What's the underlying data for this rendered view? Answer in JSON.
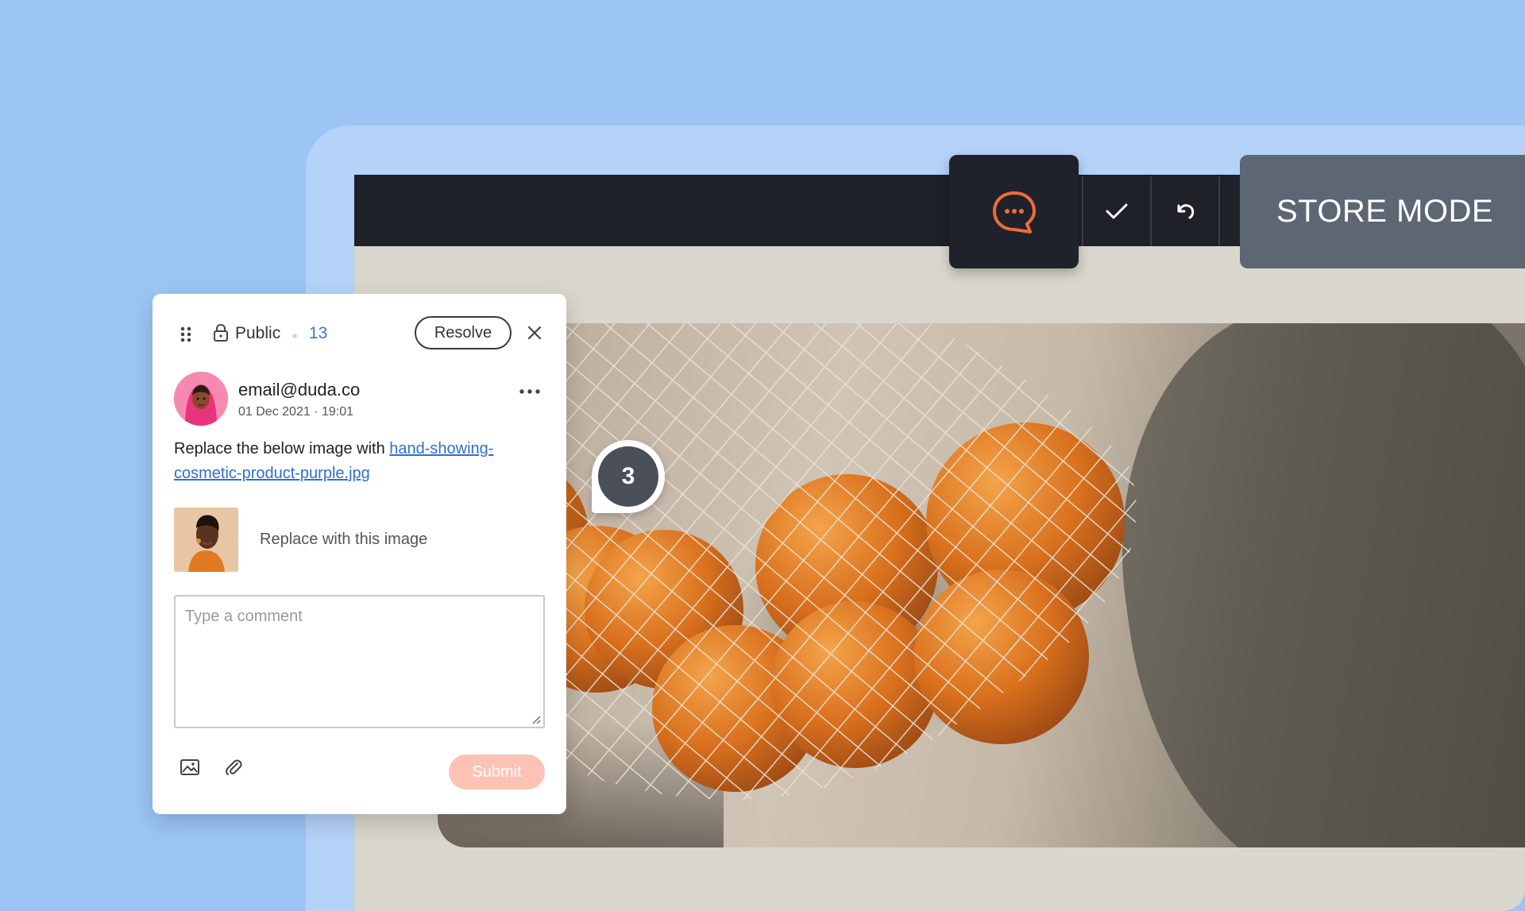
{
  "colors": {
    "background": "#9cc5f5",
    "accent_orange": "#ef6b3a",
    "link": "#2f6fcf",
    "count": "#2f7bd6",
    "submit_disabled": "#fcc3b5",
    "toolbar_dark": "#1f2129",
    "store_mode_bg": "#5d6673"
  },
  "toolbar": {
    "comments_icon": "chat-bubble-icon",
    "approve_icon": "checkmark-icon",
    "undo_icon": "undo-icon",
    "store_mode_label": "STORE MODE"
  },
  "canvas": {
    "pin_number": "3"
  },
  "comment_panel": {
    "visibility_label": "Public",
    "comment_count": "13",
    "resolve_label": "Resolve",
    "author": "email@duda.co",
    "date": "01 Dec 2021 · 19:01",
    "message_text": "Replace the below image with ",
    "message_link": "hand-showing-cosmetic-product-purple.jpg",
    "attachment_caption": "Replace with this image",
    "comment_placeholder": "Type a comment",
    "submit_label": "Submit"
  }
}
